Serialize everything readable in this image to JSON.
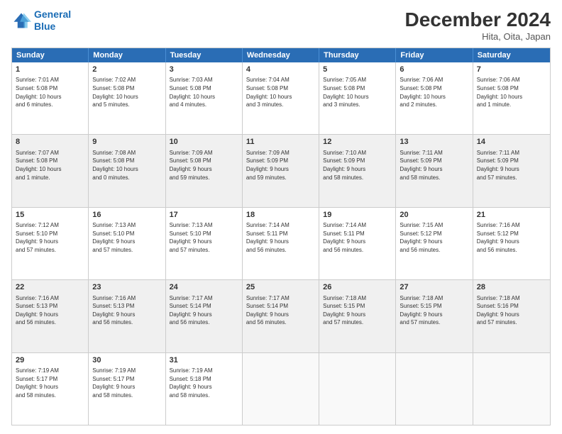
{
  "header": {
    "logo_line1": "General",
    "logo_line2": "Blue",
    "month": "December 2024",
    "location": "Hita, Oita, Japan"
  },
  "weekdays": [
    "Sunday",
    "Monday",
    "Tuesday",
    "Wednesday",
    "Thursday",
    "Friday",
    "Saturday"
  ],
  "rows": [
    [
      {
        "day": "1",
        "lines": [
          "Sunrise: 7:01 AM",
          "Sunset: 5:08 PM",
          "Daylight: 10 hours",
          "and 6 minutes."
        ]
      },
      {
        "day": "2",
        "lines": [
          "Sunrise: 7:02 AM",
          "Sunset: 5:08 PM",
          "Daylight: 10 hours",
          "and 5 minutes."
        ]
      },
      {
        "day": "3",
        "lines": [
          "Sunrise: 7:03 AM",
          "Sunset: 5:08 PM",
          "Daylight: 10 hours",
          "and 4 minutes."
        ]
      },
      {
        "day": "4",
        "lines": [
          "Sunrise: 7:04 AM",
          "Sunset: 5:08 PM",
          "Daylight: 10 hours",
          "and 3 minutes."
        ]
      },
      {
        "day": "5",
        "lines": [
          "Sunrise: 7:05 AM",
          "Sunset: 5:08 PM",
          "Daylight: 10 hours",
          "and 3 minutes."
        ]
      },
      {
        "day": "6",
        "lines": [
          "Sunrise: 7:06 AM",
          "Sunset: 5:08 PM",
          "Daylight: 10 hours",
          "and 2 minutes."
        ]
      },
      {
        "day": "7",
        "lines": [
          "Sunrise: 7:06 AM",
          "Sunset: 5:08 PM",
          "Daylight: 10 hours",
          "and 1 minute."
        ]
      }
    ],
    [
      {
        "day": "8",
        "lines": [
          "Sunrise: 7:07 AM",
          "Sunset: 5:08 PM",
          "Daylight: 10 hours",
          "and 1 minute."
        ]
      },
      {
        "day": "9",
        "lines": [
          "Sunrise: 7:08 AM",
          "Sunset: 5:08 PM",
          "Daylight: 10 hours",
          "and 0 minutes."
        ]
      },
      {
        "day": "10",
        "lines": [
          "Sunrise: 7:09 AM",
          "Sunset: 5:08 PM",
          "Daylight: 9 hours",
          "and 59 minutes."
        ]
      },
      {
        "day": "11",
        "lines": [
          "Sunrise: 7:09 AM",
          "Sunset: 5:09 PM",
          "Daylight: 9 hours",
          "and 59 minutes."
        ]
      },
      {
        "day": "12",
        "lines": [
          "Sunrise: 7:10 AM",
          "Sunset: 5:09 PM",
          "Daylight: 9 hours",
          "and 58 minutes."
        ]
      },
      {
        "day": "13",
        "lines": [
          "Sunrise: 7:11 AM",
          "Sunset: 5:09 PM",
          "Daylight: 9 hours",
          "and 58 minutes."
        ]
      },
      {
        "day": "14",
        "lines": [
          "Sunrise: 7:11 AM",
          "Sunset: 5:09 PM",
          "Daylight: 9 hours",
          "and 57 minutes."
        ]
      }
    ],
    [
      {
        "day": "15",
        "lines": [
          "Sunrise: 7:12 AM",
          "Sunset: 5:10 PM",
          "Daylight: 9 hours",
          "and 57 minutes."
        ]
      },
      {
        "day": "16",
        "lines": [
          "Sunrise: 7:13 AM",
          "Sunset: 5:10 PM",
          "Daylight: 9 hours",
          "and 57 minutes."
        ]
      },
      {
        "day": "17",
        "lines": [
          "Sunrise: 7:13 AM",
          "Sunset: 5:10 PM",
          "Daylight: 9 hours",
          "and 57 minutes."
        ]
      },
      {
        "day": "18",
        "lines": [
          "Sunrise: 7:14 AM",
          "Sunset: 5:11 PM",
          "Daylight: 9 hours",
          "and 56 minutes."
        ]
      },
      {
        "day": "19",
        "lines": [
          "Sunrise: 7:14 AM",
          "Sunset: 5:11 PM",
          "Daylight: 9 hours",
          "and 56 minutes."
        ]
      },
      {
        "day": "20",
        "lines": [
          "Sunrise: 7:15 AM",
          "Sunset: 5:12 PM",
          "Daylight: 9 hours",
          "and 56 minutes."
        ]
      },
      {
        "day": "21",
        "lines": [
          "Sunrise: 7:16 AM",
          "Sunset: 5:12 PM",
          "Daylight: 9 hours",
          "and 56 minutes."
        ]
      }
    ],
    [
      {
        "day": "22",
        "lines": [
          "Sunrise: 7:16 AM",
          "Sunset: 5:13 PM",
          "Daylight: 9 hours",
          "and 56 minutes."
        ]
      },
      {
        "day": "23",
        "lines": [
          "Sunrise: 7:16 AM",
          "Sunset: 5:13 PM",
          "Daylight: 9 hours",
          "and 56 minutes."
        ]
      },
      {
        "day": "24",
        "lines": [
          "Sunrise: 7:17 AM",
          "Sunset: 5:14 PM",
          "Daylight: 9 hours",
          "and 56 minutes."
        ]
      },
      {
        "day": "25",
        "lines": [
          "Sunrise: 7:17 AM",
          "Sunset: 5:14 PM",
          "Daylight: 9 hours",
          "and 56 minutes."
        ]
      },
      {
        "day": "26",
        "lines": [
          "Sunrise: 7:18 AM",
          "Sunset: 5:15 PM",
          "Daylight: 9 hours",
          "and 57 minutes."
        ]
      },
      {
        "day": "27",
        "lines": [
          "Sunrise: 7:18 AM",
          "Sunset: 5:15 PM",
          "Daylight: 9 hours",
          "and 57 minutes."
        ]
      },
      {
        "day": "28",
        "lines": [
          "Sunrise: 7:18 AM",
          "Sunset: 5:16 PM",
          "Daylight: 9 hours",
          "and 57 minutes."
        ]
      }
    ],
    [
      {
        "day": "29",
        "lines": [
          "Sunrise: 7:19 AM",
          "Sunset: 5:17 PM",
          "Daylight: 9 hours",
          "and 58 minutes."
        ]
      },
      {
        "day": "30",
        "lines": [
          "Sunrise: 7:19 AM",
          "Sunset: 5:17 PM",
          "Daylight: 9 hours",
          "and 58 minutes."
        ]
      },
      {
        "day": "31",
        "lines": [
          "Sunrise: 7:19 AM",
          "Sunset: 5:18 PM",
          "Daylight: 9 hours",
          "and 58 minutes."
        ]
      },
      null,
      null,
      null,
      null
    ]
  ]
}
